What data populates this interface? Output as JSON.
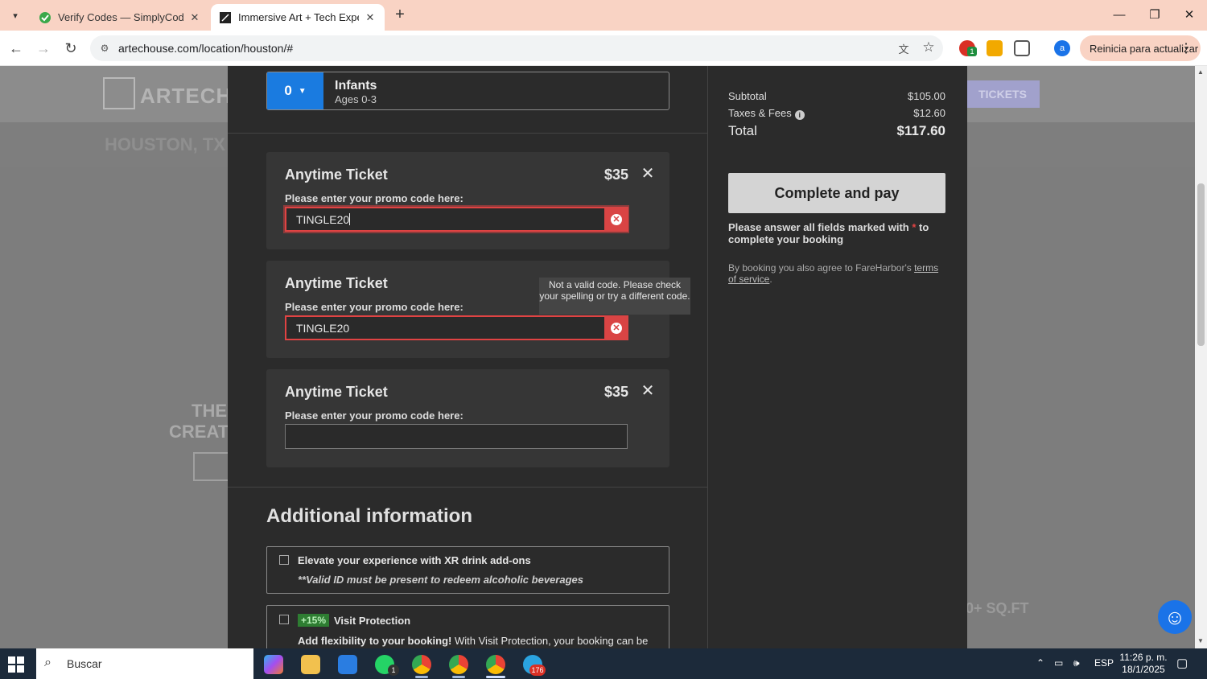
{
  "browser": {
    "tabs": [
      {
        "title": "Verify Codes — SimplyCodes",
        "active": false
      },
      {
        "title": "Immersive Art + Tech Experienc",
        "active": true
      }
    ],
    "url": "artechouse.com/location/houston/#",
    "update_label": "Reinicia para actualizar",
    "extension_badge": "1",
    "profile_initial": "a"
  },
  "background_page": {
    "brand": "ARTECHOU",
    "city": "HOUSTON, TX",
    "tickets_button": "TICKETS",
    "hero_line1": "THE",
    "hero_line2": "CREAT",
    "area_fragment": "0+ SQ.FT"
  },
  "booking": {
    "infants": {
      "quantity": "0",
      "label": "Infants",
      "sublabel": "Ages 0-3"
    },
    "tickets": [
      {
        "name": "Anytime Ticket",
        "price": "$35",
        "promo_label": "Please enter your promo code here:",
        "promo_value": "TINGLE20",
        "error": true,
        "focused": true
      },
      {
        "name": "Anytime Ticket",
        "price": "$35",
        "promo_label": "Please enter your promo code here:",
        "promo_value": "TINGLE20",
        "error": true,
        "focused": false
      },
      {
        "name": "Anytime Ticket",
        "price": "$35",
        "promo_label": "Please enter your promo code here:",
        "promo_value": "",
        "error": false,
        "focused": false
      }
    ],
    "tooltip": "Not a valid code. Please check your spelling or try a different code.",
    "additional_title": "Additional information",
    "addons": [
      {
        "title": "Elevate your experience with XR drink add-ons",
        "note": "**Valid ID must be present to redeem alcoholic beverages"
      },
      {
        "badge": "+15%",
        "title": "Visit Protection",
        "desc_bold": "Add flexibility to your booking!",
        "desc_rest": " With Visit Protection, your booking can be"
      }
    ],
    "summary": {
      "subtotal_label": "Subtotal",
      "subtotal": "$105.00",
      "taxes_label": "Taxes & Fees",
      "taxes": "$12.60",
      "total_label": "Total",
      "total": "$117.60",
      "pay_button": "Complete and pay",
      "required_note_pre": "Please answer all fields marked with ",
      "required_star": "*",
      "required_note_post": " to complete your booking",
      "terms_pre": "By booking you also agree to FareHarbor's ",
      "terms_link": "terms of service",
      "terms_post": "."
    }
  },
  "taskbar": {
    "search_placeholder": "Buscar",
    "language": "ESP",
    "time": "11:26 p. m.",
    "date": "18/1/2025",
    "whatsapp_badge": "1",
    "telegram_badge": "176"
  }
}
